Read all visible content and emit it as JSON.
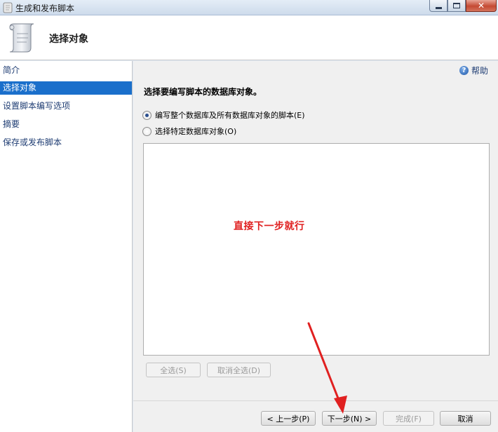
{
  "window": {
    "title": "生成和发布脚本",
    "close_glyph": "✕"
  },
  "header": {
    "title": "选择对象"
  },
  "nav": {
    "items": [
      {
        "label": "简介",
        "active": false
      },
      {
        "label": "选择对象",
        "active": true
      },
      {
        "label": "设置脚本编写选项",
        "active": false
      },
      {
        "label": "摘要",
        "active": false
      },
      {
        "label": "保存或发布脚本",
        "active": false
      }
    ]
  },
  "main": {
    "help_label": "帮助",
    "help_glyph": "?",
    "instruction": "选择要编写脚本的数据库对象。",
    "options": [
      {
        "label": "编写整个数据库及所有数据库对象的脚本(E)",
        "checked": true
      },
      {
        "label": "选择特定数据库对象(O)",
        "checked": false
      }
    ],
    "overlay_note": "直接下一步就行",
    "select_all_label": "全选(S)",
    "deselect_all_label": "取消全选(D)"
  },
  "footer": {
    "prev_label": "< 上一步(P)",
    "next_label": "下一步(N) >",
    "finish_label": "完成(F)",
    "cancel_label": "取消"
  },
  "colors": {
    "nav_active_bg": "#1a6fcb",
    "annotation_red": "#e02020"
  },
  "icons": {
    "app": "scroll-icon",
    "header": "scroll-icon",
    "help": "help-icon"
  }
}
